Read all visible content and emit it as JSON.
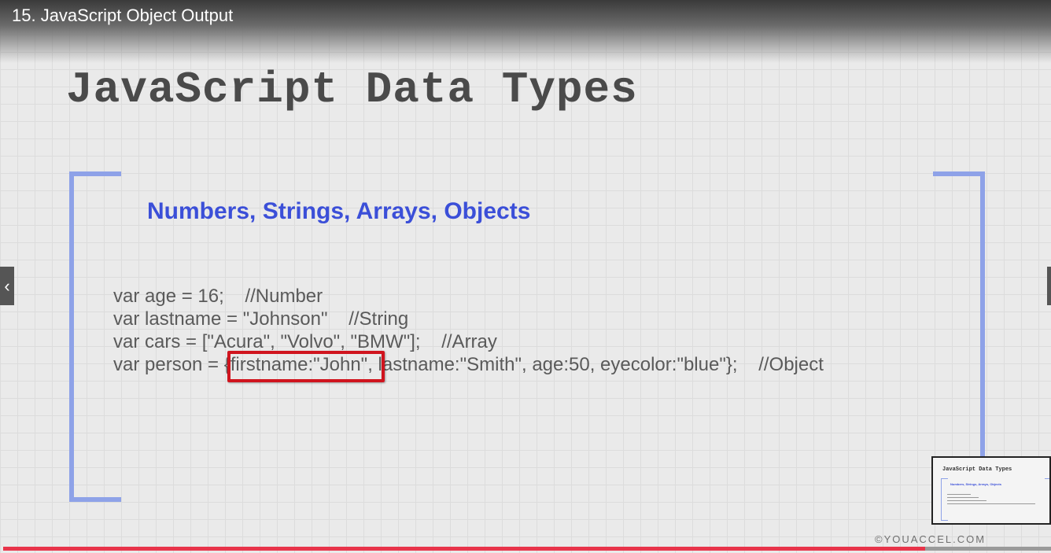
{
  "video": {
    "title": "15. JavaScript Object Output",
    "progress_percent": 88
  },
  "slide": {
    "title": "JavaScript Data Types",
    "subtitle": "Numbers, Strings, Arrays, Objects",
    "code_lines": [
      "var age = 16;    //Number",
      "var lastname = \"Johnson\"    //String",
      "var cars = [\"Acura\", \"Volvo\", \"BMW\"];    //Array",
      "var person = {firstname:\"John\", lastname:\"Smith\", age:50, eyecolor:\"blue\"};    //Object"
    ],
    "highlight_text": "{firstname:\"John\""
  },
  "thumbnail": {
    "title": "JavaScript Data Types",
    "subtitle": "Numbers, Strings, Arrays, Objects"
  },
  "watermark": "©YOUACCEL.COM",
  "nav": {
    "prev_icon": "chevron-left-icon"
  },
  "colors": {
    "bracket": "#8ea2e8",
    "subtitle": "#3b4fd8",
    "highlight": "#d0141e",
    "progress": "#e8344a"
  }
}
